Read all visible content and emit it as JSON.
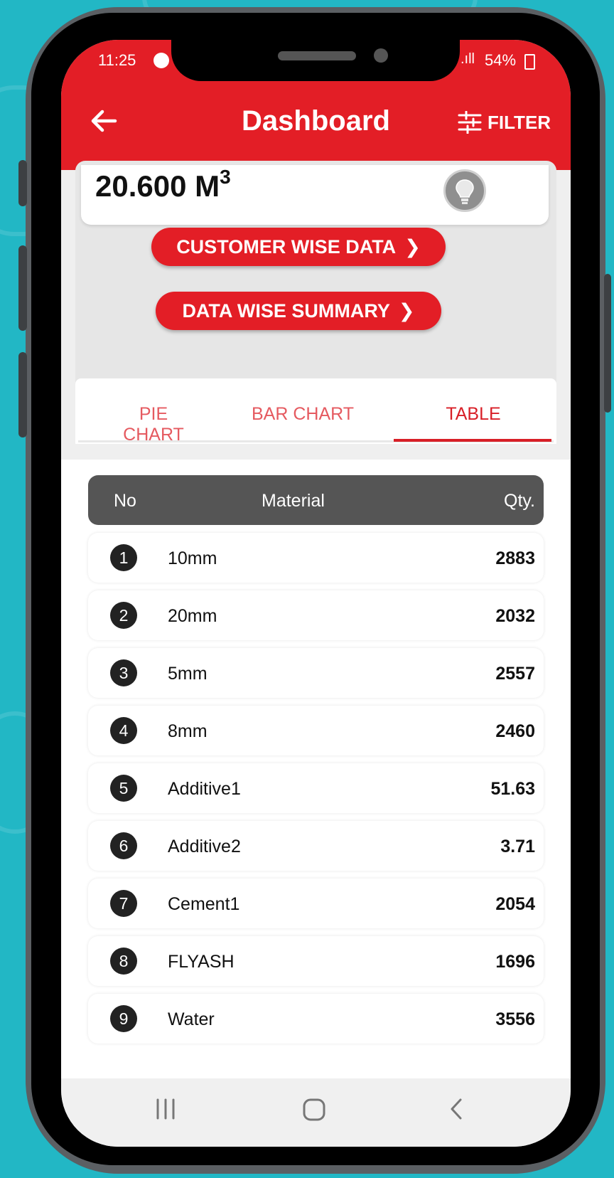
{
  "status": {
    "time": "11:25",
    "signal": ".ıll",
    "battery": "54%"
  },
  "header": {
    "title": "Dashboard",
    "filter_label": "FILTER"
  },
  "summary": {
    "value": "20.600 M",
    "unit_power": "3",
    "icon": "lightbulb-icon"
  },
  "buttons": {
    "customer_wise": "CUSTOMER WISE DATA",
    "data_wise": "DATA WISE SUMMARY",
    "chevron": "❯"
  },
  "tabs": [
    {
      "label": "PIE CHART",
      "active": false
    },
    {
      "label": "BAR CHART",
      "active": false
    },
    {
      "label": "TABLE",
      "active": true
    }
  ],
  "table": {
    "headers": {
      "no": "No",
      "material": "Material",
      "qty": "Qty."
    },
    "rows": [
      {
        "no": "1",
        "material": "10mm",
        "qty": "2883"
      },
      {
        "no": "2",
        "material": "20mm",
        "qty": "2032"
      },
      {
        "no": "3",
        "material": "5mm",
        "qty": "2557"
      },
      {
        "no": "4",
        "material": "8mm",
        "qty": "2460"
      },
      {
        "no": "5",
        "material": "Additive1",
        "qty": "51.63"
      },
      {
        "no": "6",
        "material": "Additive2",
        "qty": "3.71"
      },
      {
        "no": "7",
        "material": "Cement1",
        "qty": "2054"
      },
      {
        "no": "8",
        "material": "FLYASH",
        "qty": "1696"
      },
      {
        "no": "9",
        "material": "Water",
        "qty": "3556"
      }
    ]
  },
  "colors": {
    "brand_red": "#e31e26",
    "background_teal": "#22b7c5",
    "table_header": "#555555"
  }
}
